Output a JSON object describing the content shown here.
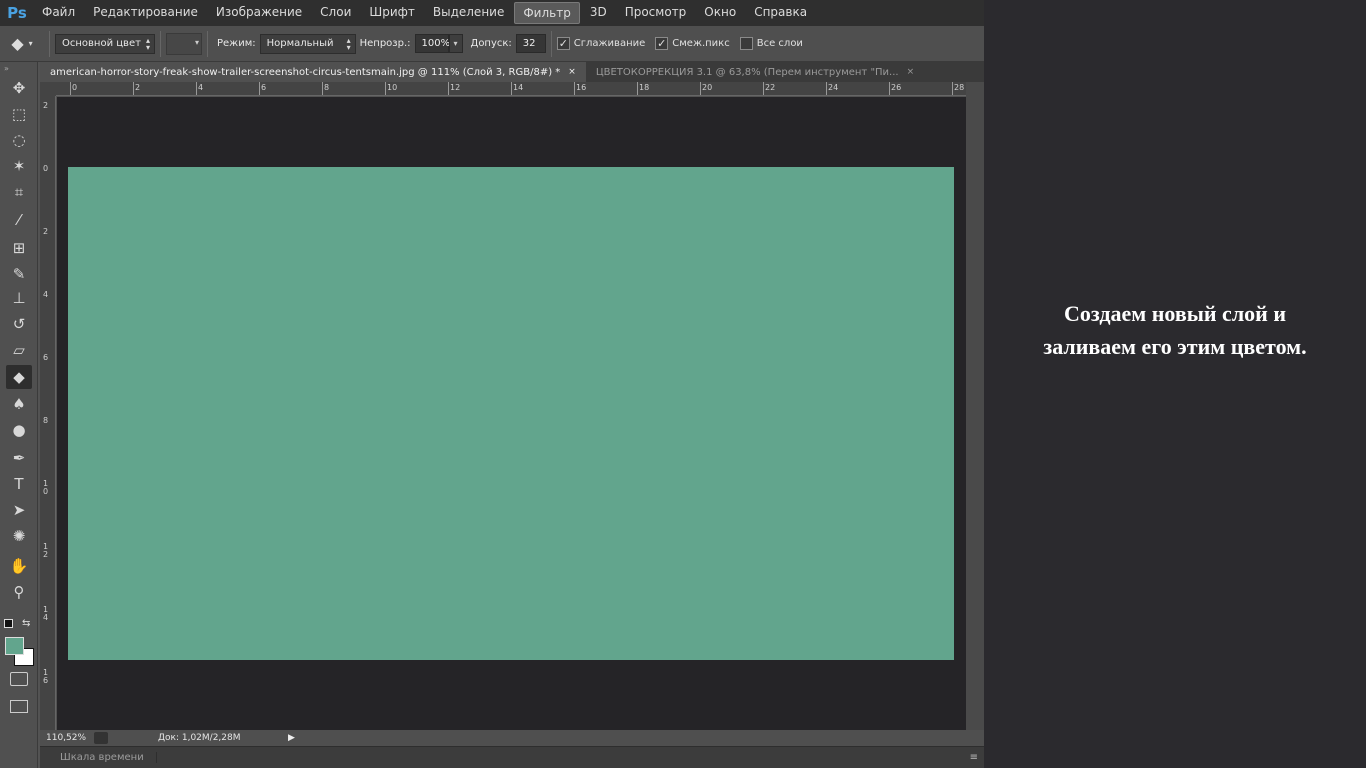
{
  "app": {
    "logo": "Ps"
  },
  "menu": [
    {
      "label": "Файл"
    },
    {
      "label": "Редактирование"
    },
    {
      "label": "Изображение"
    },
    {
      "label": "Слои"
    },
    {
      "label": "Шрифт"
    },
    {
      "label": "Выделение"
    },
    {
      "label": "Фильтр",
      "active": true
    },
    {
      "label": "3D"
    },
    {
      "label": "Просмотр"
    },
    {
      "label": "Окно"
    },
    {
      "label": "Справка"
    }
  ],
  "options": {
    "fill_source": "Основной цвет",
    "mode_label": "Режим:",
    "mode_value": "Нормальный",
    "opacity_label": "Непрозр.:",
    "opacity_value": "100%",
    "tolerance_label": "Допуск:",
    "tolerance_value": "32",
    "antialias_label": "Сглаживание",
    "antialias_checked": true,
    "contiguous_label": "Смеж.пикс",
    "contiguous_checked": true,
    "all_layers_label": "Все слои",
    "all_layers_checked": false,
    "check_glyph": "✓"
  },
  "tools": [
    {
      "name": "move-tool-icon",
      "glyph": "✥"
    },
    {
      "name": "marquee-tool-icon",
      "glyph": "⬚"
    },
    {
      "name": "lasso-tool-icon",
      "glyph": "◌"
    },
    {
      "name": "magic-wand-tool-icon",
      "glyph": "✶"
    },
    {
      "name": "crop-tool-icon",
      "glyph": "⌗"
    },
    {
      "name": "eyedropper-tool-icon",
      "glyph": "⁄"
    },
    {
      "name": "healing-brush-tool-icon",
      "glyph": "⊞"
    },
    {
      "name": "brush-tool-icon",
      "glyph": "✎"
    },
    {
      "name": "clone-stamp-tool-icon",
      "glyph": "⊥"
    },
    {
      "name": "history-brush-tool-icon",
      "glyph": "↺"
    },
    {
      "name": "eraser-tool-icon",
      "glyph": "▱"
    },
    {
      "name": "paint-bucket-tool-icon",
      "glyph": "◆",
      "active": true
    },
    {
      "name": "blur-tool-icon",
      "glyph": "♠"
    },
    {
      "name": "dodge-tool-icon",
      "glyph": "●"
    },
    {
      "name": "pen-tool-icon",
      "glyph": "✒"
    },
    {
      "name": "type-tool-icon",
      "glyph": "T"
    },
    {
      "name": "path-selection-tool-icon",
      "glyph": "➤"
    },
    {
      "name": "custom-shape-tool-icon",
      "glyph": "✺"
    },
    {
      "name": "hand-tool-icon",
      "glyph": "✋"
    },
    {
      "name": "zoom-tool-icon",
      "glyph": "⚲"
    }
  ],
  "colors": {
    "foreground": "#62a58d",
    "background": "#ffffff",
    "canvas_fill": "#62a58d",
    "pasteboard": "#252427",
    "accent": "#4aa2e2"
  },
  "tabs": [
    {
      "label": "american-horror-story-freak-show-trailer-screenshot-circus-tentsmain.jpg @ 111% (Слой 3, RGB/8#) *",
      "active": true
    },
    {
      "label": "ЦВЕТОКОРРЕКЦИЯ 3.1 @ 63,8% (Перем инструмент \"Пи...",
      "active": false
    }
  ],
  "tab_close": "×",
  "ruler": {
    "top_ticks": [
      "0",
      "2",
      "4",
      "6",
      "8",
      "10",
      "12",
      "14",
      "16",
      "18",
      "20",
      "22",
      "24",
      "26",
      "28"
    ],
    "left_ticks": [
      "2",
      "0",
      "2",
      "4",
      "6",
      "8",
      "10",
      "12",
      "14",
      "16"
    ]
  },
  "status": {
    "zoom": "110,52%",
    "doc_info": "Док: 1,02M/2,28M"
  },
  "timeline": {
    "label": "Шкала времени"
  },
  "caption": {
    "line1": "Создаем новый слой и",
    "line2": "заливаем его этим цветом."
  }
}
